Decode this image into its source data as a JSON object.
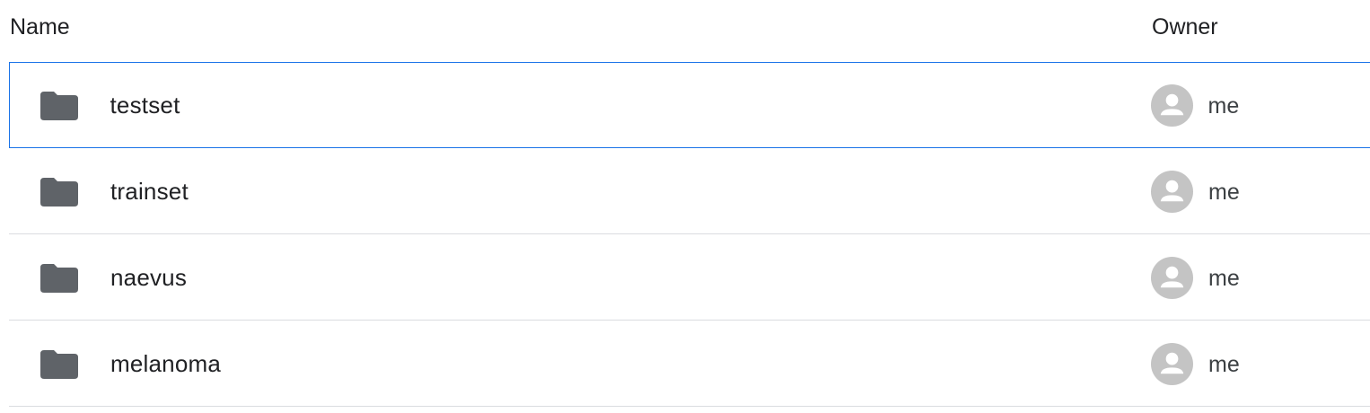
{
  "header": {
    "name_label": "Name",
    "owner_label": "Owner"
  },
  "colors": {
    "selection_border": "#1a73e8",
    "folder_icon": "#5f6368",
    "avatar": "#c4c4c4",
    "divider": "#dadce0"
  },
  "rows": [
    {
      "name": "testset",
      "owner": "me",
      "icon": "folder-icon",
      "selected": true
    },
    {
      "name": "trainset",
      "owner": "me",
      "icon": "folder-icon",
      "selected": false
    },
    {
      "name": "naevus",
      "owner": "me",
      "icon": "folder-icon",
      "selected": false
    },
    {
      "name": "melanoma",
      "owner": "me",
      "icon": "folder-icon",
      "selected": false
    }
  ]
}
